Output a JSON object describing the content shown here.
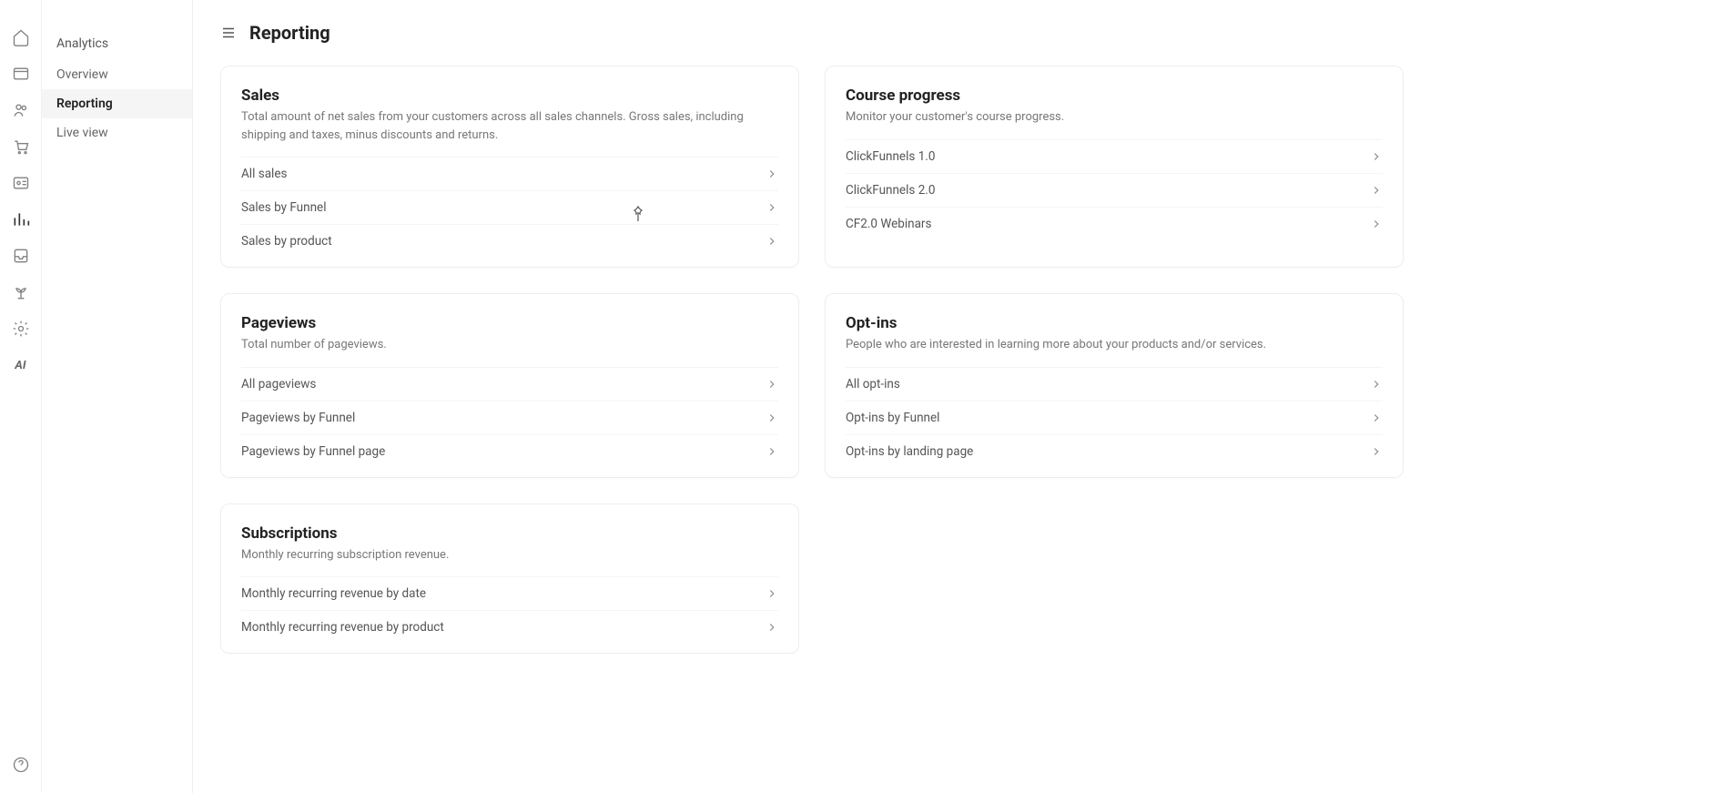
{
  "sidebar": {
    "title": "Analytics",
    "items": [
      {
        "label": "Overview"
      },
      {
        "label": "Reporting"
      },
      {
        "label": "Live view"
      }
    ]
  },
  "header": {
    "title": "Reporting"
  },
  "cards": {
    "sales": {
      "title": "Sales",
      "desc": "Total amount of net sales from your customers across all sales channels. Gross sales, including shipping and taxes, minus discounts and returns.",
      "rows": [
        {
          "label": "All sales"
        },
        {
          "label": "Sales by Funnel"
        },
        {
          "label": "Sales by product"
        }
      ]
    },
    "course": {
      "title": "Course progress",
      "desc": "Monitor your customer's course progress.",
      "rows": [
        {
          "label": "ClickFunnels 1.0"
        },
        {
          "label": "ClickFunnels 2.0"
        },
        {
          "label": "CF2.0 Webinars"
        }
      ]
    },
    "pageviews": {
      "title": "Pageviews",
      "desc": "Total number of pageviews.",
      "rows": [
        {
          "label": "All pageviews"
        },
        {
          "label": "Pageviews by Funnel"
        },
        {
          "label": "Pageviews by Funnel page"
        }
      ]
    },
    "optins": {
      "title": "Opt-ins",
      "desc": "People who are interested in learning more about your products and/or services.",
      "rows": [
        {
          "label": "All opt-ins"
        },
        {
          "label": "Opt-ins by Funnel"
        },
        {
          "label": "Opt-ins by landing page"
        }
      ]
    },
    "subscriptions": {
      "title": "Subscriptions",
      "desc": "Monthly recurring subscription revenue.",
      "rows": [
        {
          "label": "Monthly recurring revenue by date"
        },
        {
          "label": "Monthly recurring revenue by product"
        }
      ]
    }
  }
}
